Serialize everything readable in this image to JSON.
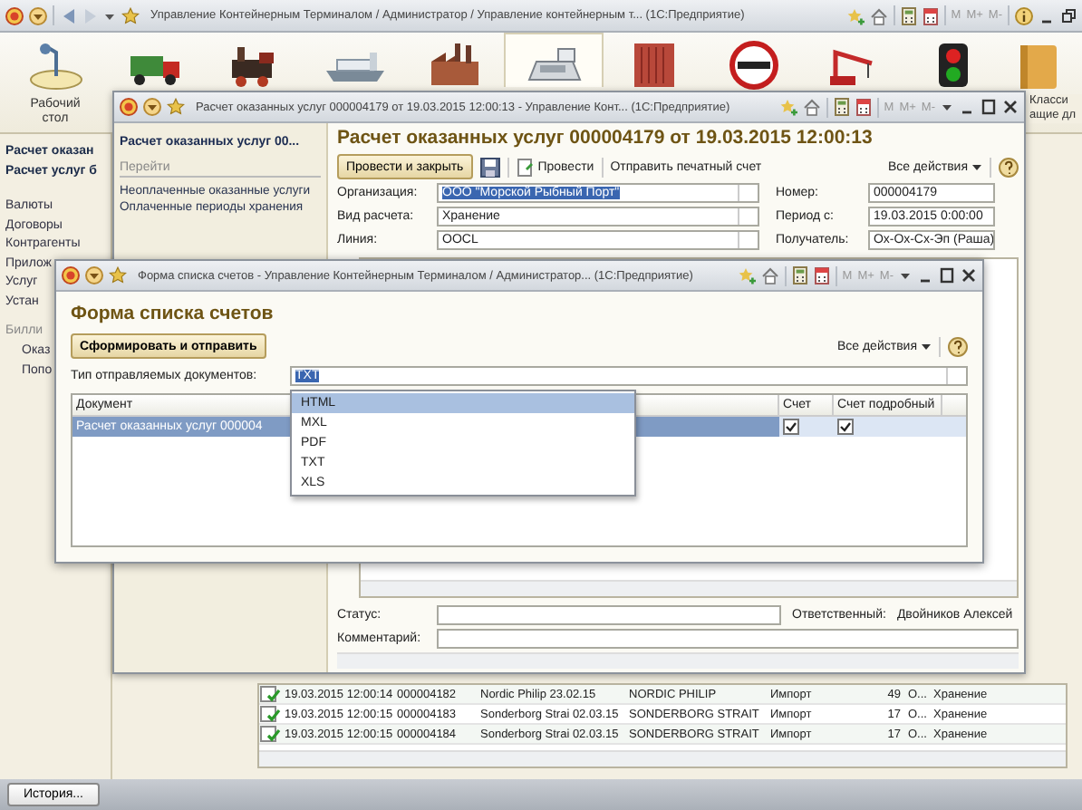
{
  "main_window": {
    "title": "Управление Контейнерным Терминалом / Администратор / Управление контейнерным т... (1С:Предприятие)",
    "memory_buttons": [
      "M",
      "M+",
      "M-"
    ]
  },
  "sections": [
    {
      "kind": "desk",
      "label": "Рабочий стол",
      "selected": false
    },
    {
      "kind": "truck",
      "selected": false
    },
    {
      "kind": "train",
      "selected": false
    },
    {
      "kind": "ship",
      "selected": false
    },
    {
      "kind": "factory",
      "selected": false
    },
    {
      "kind": "register",
      "selected": true
    },
    {
      "kind": "container",
      "selected": false
    },
    {
      "kind": "customs",
      "selected": false
    },
    {
      "kind": "crane",
      "selected": false
    },
    {
      "kind": "traffic-light",
      "selected": false
    },
    {
      "kind": "book",
      "label": "Класси ащие дл",
      "selected": false
    }
  ],
  "navigation": [
    {
      "kind": "current",
      "label": "Расчет оказан"
    },
    {
      "kind": "current",
      "label": "Расчет услуг б"
    },
    {
      "kind": "link",
      "label": "Валюты"
    },
    {
      "kind": "link",
      "label": "Договоры"
    },
    {
      "kind": "link",
      "label": "Контрагенты"
    },
    {
      "kind": "link",
      "label": "Прилож"
    },
    {
      "kind": "link",
      "label": "Услуг"
    },
    {
      "kind": "link",
      "label": "Устан"
    },
    {
      "kind": "group",
      "label": "Билли",
      "children": [
        {
          "kind": "link",
          "label": "Оказ"
        },
        {
          "kind": "link",
          "label": "Попо"
        }
      ]
    }
  ],
  "background_list": {
    "rows": [
      {
        "posted": true,
        "cells": [
          "19.03.2015 12:00:14",
          "000004182",
          "Nordic Philip 23.02.15",
          "NORDIC PHILIP",
          "Импорт",
          "49",
          "О...",
          "Хранение"
        ]
      },
      {
        "posted": true,
        "cells": [
          "19.03.2015 12:00:15",
          "000004183",
          "Sonderborg Strai 02.03.15",
          "SONDERBORG STRAIT",
          "Импорт",
          "17",
          "О...",
          "Хранение"
        ]
      },
      {
        "posted": true,
        "cells": [
          "19.03.2015 12:00:15",
          "000004184",
          "Sonderborg Strai 02.03.15",
          "SONDERBORG STRAIT",
          "Импорт",
          "17",
          "О...",
          "Хранение"
        ]
      }
    ]
  },
  "history_button": "История...",
  "document_window": {
    "title": "Расчет оказанных услуг 000004179 от 19.03.2015 12:00:13 - Управление Конт... (1С:Предприятие)",
    "memory_buttons": [
      "M",
      "M+",
      "M-"
    ],
    "sidebar": {
      "title": "Расчет оказанных услуг 00...",
      "section": "Перейти",
      "links": [
        "Неоплаченные оказанные услуги",
        "Оплаченные периоды хранения"
      ]
    },
    "heading": "Расчет оказанных услуг 000004179 от 19.03.2015 12:00:13",
    "toolbar": [
      {
        "kind": "default",
        "label": "Провести и закрыть"
      },
      {
        "kind": "save"
      },
      {
        "kind": "post",
        "label": "Провести"
      },
      {
        "kind": "plain",
        "label": "Отправить печатный счет"
      }
    ],
    "all_actions": "Все действия",
    "fields": [
      {
        "label": "Организация:",
        "value": "ООО \"Морской Рыбный Порт\"",
        "highlighted": true,
        "side_label": "Номер:",
        "side_value": "000004179"
      },
      {
        "label": "Вид расчета:",
        "value": "Хранение",
        "highlighted": false,
        "side_label": "Период с:",
        "side_value": "19.03.2015  0:00:00"
      },
      {
        "label": "Линия:",
        "value": "OOCL",
        "highlighted": false,
        "side_label": "Получатель:",
        "side_value": "Ох-Ох-Сх-Эп (Раша)"
      }
    ],
    "status": {
      "label": "Статус:",
      "responsible_label": "Ответственный:",
      "responsible": "Двойников Алексей"
    },
    "comment": {
      "label": "Комментарий:"
    }
  },
  "list_window": {
    "title": "Форма списка счетов - Управление Контейнерным Терминалом / Администратор... (1С:Предприятие)",
    "memory_buttons": [
      "M",
      "M+",
      "M-"
    ],
    "heading": "Форма списка счетов",
    "button": "Сформировать и отправить",
    "all_actions": "Все действия",
    "type_field": {
      "label": "Тип отправляемых документов:",
      "value": "TXT",
      "highlighted": true
    },
    "dropdown": [
      {
        "label": "HTML",
        "selected": true
      },
      {
        "label": "MXL",
        "selected": false
      },
      {
        "label": "PDF",
        "selected": false
      },
      {
        "label": "TXT",
        "selected": false
      },
      {
        "label": "XLS",
        "selected": false
      }
    ],
    "table": {
      "columns": [
        "Документ",
        "Счет",
        "Счет подробный"
      ],
      "rows": [
        {
          "document": "Расчет оказанных услуг 000004",
          "invoice": true,
          "detailed": true,
          "selected": true
        }
      ]
    }
  }
}
